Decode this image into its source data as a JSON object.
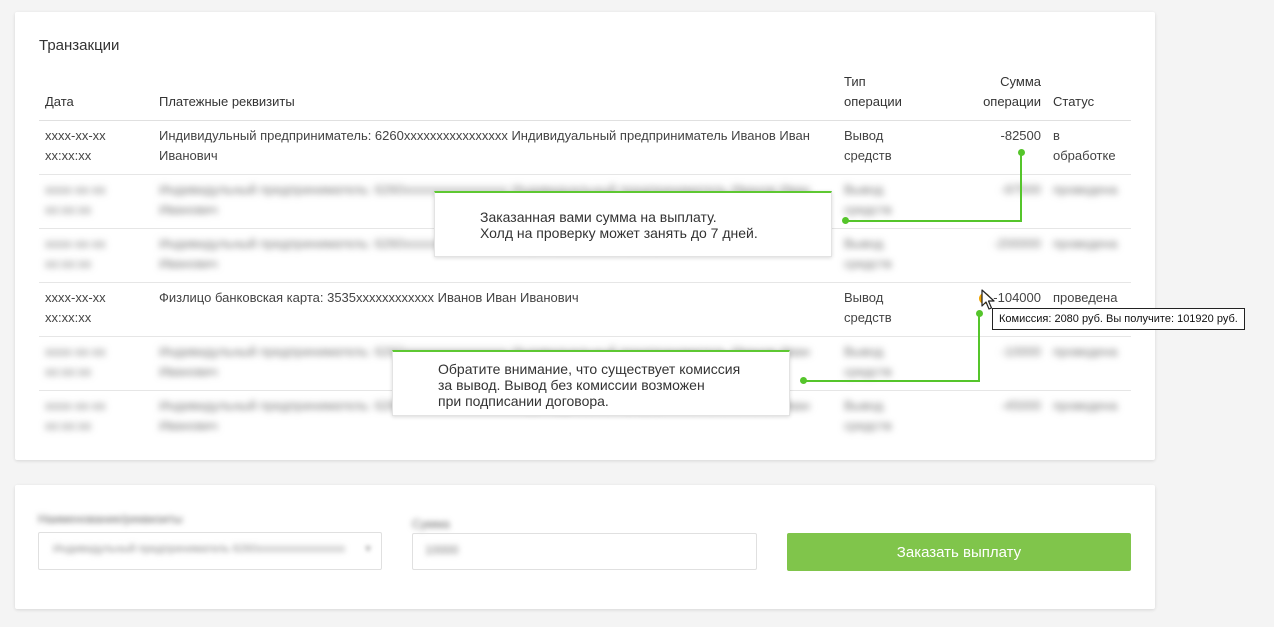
{
  "transactions": {
    "title": "Транзакции",
    "columns": {
      "date": "Дата",
      "details": "Платежные реквизиты",
      "type_line1": "Тип",
      "type_line2": "операции",
      "amount_line1": "Сумма",
      "amount_line2": "операции",
      "status": "Статус"
    },
    "rows": [
      {
        "date1": "xxxx-xx-xx",
        "date2": "xx:xx:xx",
        "details": "Индивидульный предприниматель: 6260xxxxxxxxxxxxxxxx Индивидуальный предприниматель Иванов Иван Иванович",
        "type1": "Вывод",
        "type2": "средств",
        "amount": "-82500",
        "status1": "в",
        "status2": "обработке"
      },
      {
        "date1": "xxxx-xx-xx",
        "date2": "xx:xx:xx",
        "details": "Индивидульный предприниматель: 6260xxxxxxxxxxxxxxxx Индивидуальный предприниматель Иванов Иван Иванович",
        "type1": "Вывод",
        "type2": "средств",
        "amount": "-97500",
        "status1": "проведена",
        "status2": ""
      },
      {
        "date1": "xxxx-xx-xx",
        "date2": "xx:xx:xx",
        "details": "Индивидульный предприниматель: 6260xxxxxxxxxxxxxxxx Индивидуальный предприниматель Иванов Иван Иванович",
        "type1": "Вывод",
        "type2": "средств",
        "amount": "-200000",
        "status1": "проведена",
        "status2": ""
      },
      {
        "date1": "xxxx-xx-xx",
        "date2": "xx:xx:xx",
        "details": "Физлицо банковская карта: 3535xxxxxxxxxxxx Иванов Иван Иванович",
        "type1": "Вывод",
        "type2": "средств",
        "amount": "-104000",
        "status1": "проведена",
        "status2": ""
      },
      {
        "date1": "xxxx-xx-xx",
        "date2": "xx:xx:xx",
        "details": "Индивидульный предприниматель: 6260xxxxxxxxxxxxxxxx Индивидуальный предприниматель Иванов Иван Иванович",
        "type1": "Вывод",
        "type2": "средств",
        "amount": "-10000",
        "status1": "проведена",
        "status2": ""
      },
      {
        "date1": "xxxx-xx-xx",
        "date2": "xx:xx:xx",
        "details": "Индивидульный предприниматель: 6260xxxxxxxxxxxxxxxx Индивидуальный предприниматель Иванов Иван Иванович",
        "type1": "Вывод",
        "type2": "средств",
        "amount": "-45000",
        "status1": "проведена",
        "status2": ""
      }
    ]
  },
  "callouts": {
    "first_line1": "Заказанная вами сумма на выплату.",
    "first_line2": "Холд на проверку может занять до 7 дней.",
    "second_line1": "Обратите внимание, что существует комиссия",
    "second_line2": "за вывод. Вывод без комиссии возможен",
    "second_line3": "при подписании договора."
  },
  "tooltip": {
    "text": "Комиссия: 2080 руб. Вы получите: 101920 руб."
  },
  "order_form": {
    "recipient_label": "Наименование/реквизиты",
    "recipient_value": "Индивидульный предприниматель 6260xxxxxxxxxxxxxxxx",
    "amount_label": "Сумма",
    "amount_value": "10000",
    "submit_label": "Заказать выплату"
  },
  "colors": {
    "accent_green": "#55c52b",
    "button_green": "#80c54b",
    "info_icon": "#f0a400"
  }
}
